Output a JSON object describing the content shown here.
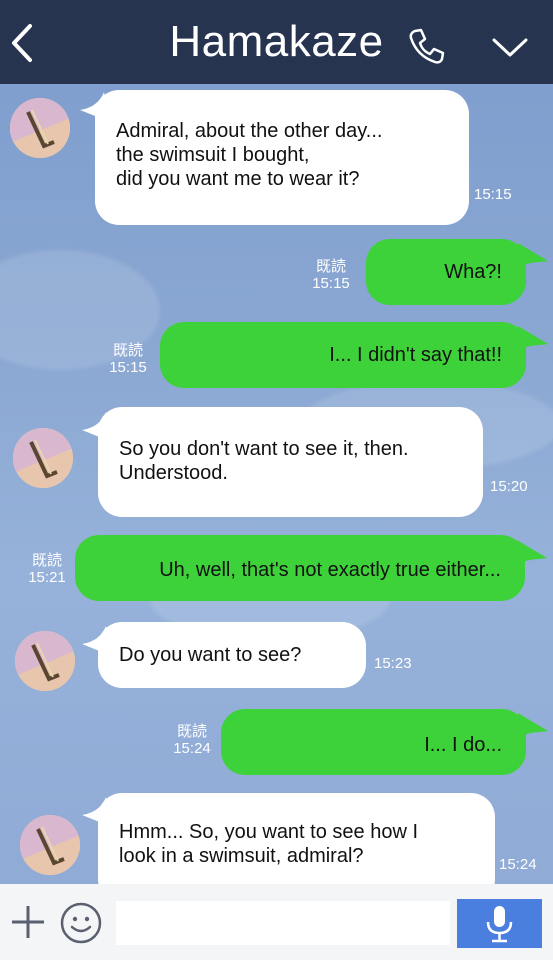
{
  "header": {
    "title": "Hamakaze",
    "back_icon": "chevron-left-icon",
    "call_icon": "phone-icon",
    "menu_icon": "chevron-down-icon",
    "bg_color": "#263450"
  },
  "messages": [
    {
      "from": "them",
      "lines": [
        "Admiral, about the other day...",
        "the swimsuit I bought,",
        "did you want me to wear it?"
      ],
      "time": "15:15"
    },
    {
      "from": "me",
      "lines": [
        "Wha?!"
      ],
      "read": "既読",
      "time": "15:15"
    },
    {
      "from": "me",
      "lines": [
        "I... I didn't say that!!"
      ],
      "read": "既読",
      "time": "15:15"
    },
    {
      "from": "them",
      "lines": [
        "So you don't want to see it, then.",
        "Understood."
      ],
      "time": "15:20"
    },
    {
      "from": "me",
      "lines": [
        "Uh, well, that's not exactly true either..."
      ],
      "read": "既読",
      "time": "15:21"
    },
    {
      "from": "them",
      "lines": [
        "Do you want to see?"
      ],
      "time": "15:23"
    },
    {
      "from": "me",
      "lines": [
        "I... I do..."
      ],
      "read": "既読",
      "time": "15:24"
    },
    {
      "from": "them",
      "lines": [
        "Hmm... So, you want to see how I",
        "look in a swimsuit, admiral?"
      ],
      "time": "15:24"
    }
  ],
  "input_bar": {
    "message_value": "",
    "plus_icon": "plus-icon",
    "emoji_icon": "emoji-icon",
    "mic_icon": "microphone-icon",
    "mic_color": "#4a7fe0"
  },
  "colors": {
    "sent_bubble": "#3ed23a",
    "received_bubble": "#ffffff",
    "chat_background": "#8aa7d2"
  }
}
